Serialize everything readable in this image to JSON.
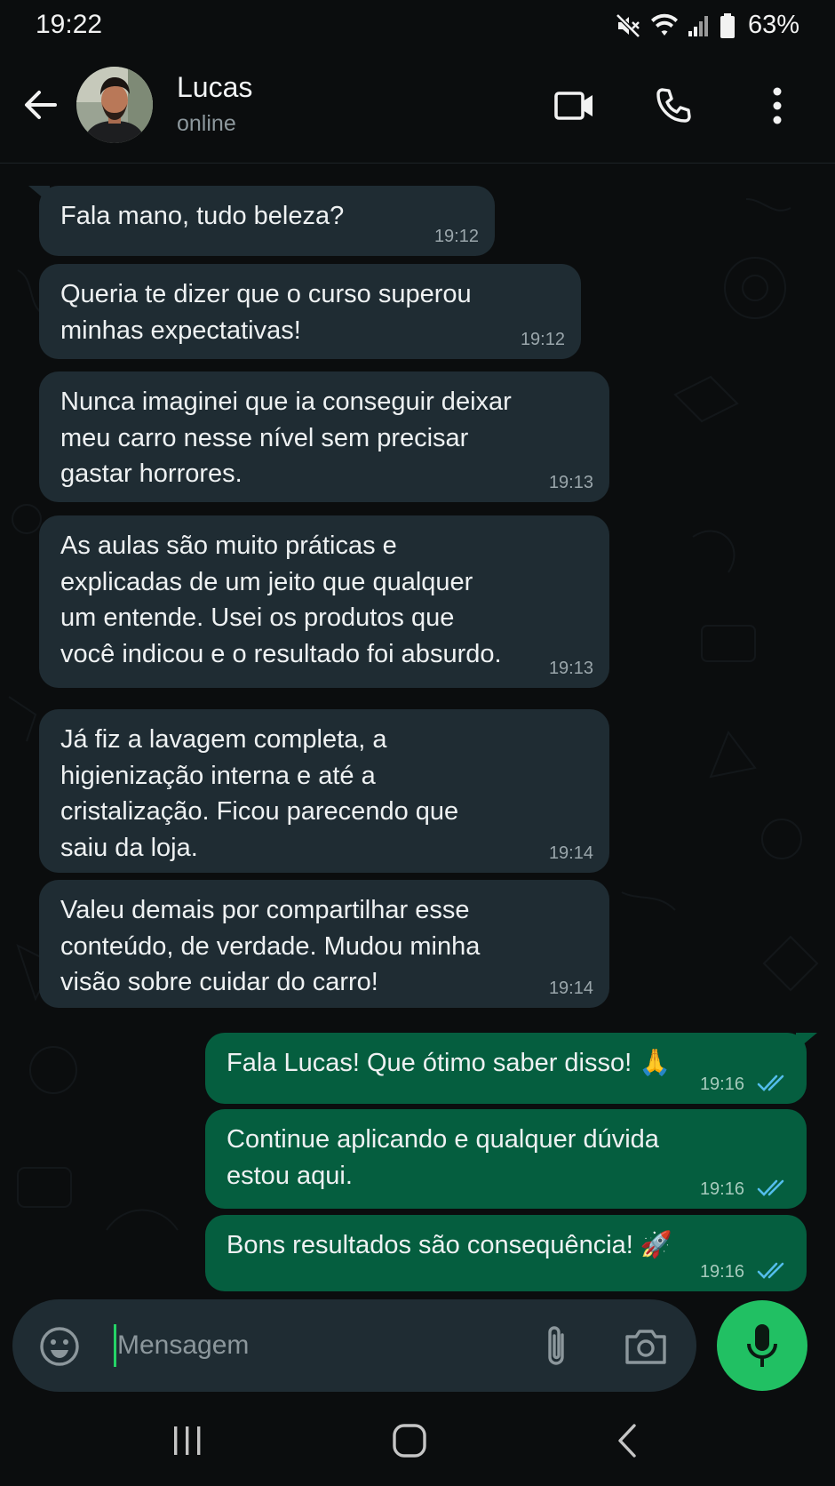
{
  "status_bar": {
    "time": "19:22",
    "battery": "63%"
  },
  "header": {
    "contact_name": "Lucas",
    "contact_status": "online"
  },
  "messages": [
    {
      "direction": "in",
      "lines": [
        "Fala mano, tudo beleza?"
      ],
      "time": "19:12"
    },
    {
      "direction": "in",
      "lines": [
        "Queria te dizer que o curso superou",
        "minhas expectativas!"
      ],
      "time": "19:12"
    },
    {
      "direction": "in",
      "lines": [
        "Nunca imaginei que ia conseguir deixar",
        "meu carro nesse nível sem precisar",
        "gastar horrores."
      ],
      "time": "19:13"
    },
    {
      "direction": "in",
      "lines": [
        "As aulas são muito práticas e",
        "explicadas de um jeito que qualquer",
        "um entende. Usei os produtos que",
        "você indicou e o resultado foi absurdo."
      ],
      "time": "19:13"
    },
    {
      "direction": "in",
      "lines": [
        "Já fiz a lavagem completa, a",
        "higienização interna e até a",
        "cristalização. Ficou parecendo que",
        "saiu da loja."
      ],
      "time": "19:14"
    },
    {
      "direction": "in",
      "lines": [
        "Valeu demais por compartilhar esse",
        "conteúdo, de verdade. Mudou minha",
        "visão sobre cuidar do carro!"
      ],
      "time": "19:14"
    },
    {
      "direction": "out",
      "lines": [
        "Fala Lucas! Que ótimo saber disso! 🙏"
      ],
      "time": "19:16",
      "read": true
    },
    {
      "direction": "out",
      "lines": [
        "Continue aplicando e qualquer dúvida",
        "estou aqui."
      ],
      "time": "19:16",
      "read": true
    },
    {
      "direction": "out",
      "lines": [
        "Bons resultados são consequência! 🚀"
      ],
      "time": "19:16",
      "read": true
    }
  ],
  "composer": {
    "placeholder": "Mensagem"
  },
  "icons": {
    "back": "arrow-left-icon",
    "video": "video-camera-icon",
    "call": "phone-icon",
    "menu": "more-vertical-icon",
    "emoji": "emoji-icon",
    "attach": "paperclip-icon",
    "camera": "camera-icon",
    "mic": "microphone-icon"
  },
  "colors": {
    "background": "#0b0d0e",
    "incoming_bubble": "#1f2c33",
    "outgoing_bubble": "#055e3f",
    "accent": "#21c063",
    "read_ticks": "#53bdeb"
  }
}
